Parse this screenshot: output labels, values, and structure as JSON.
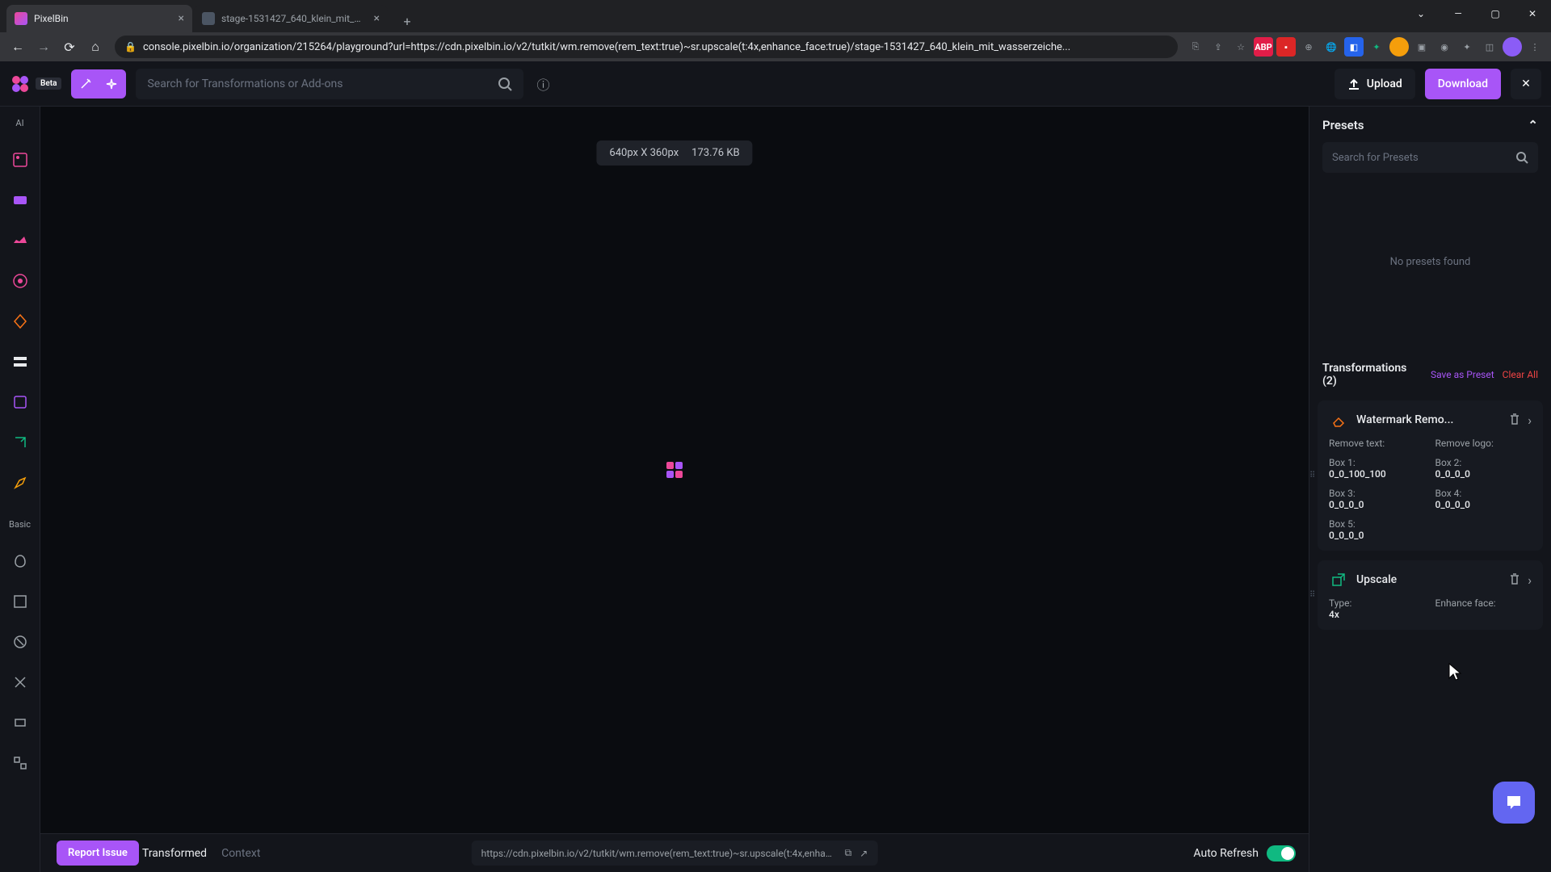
{
  "browser": {
    "tabs": [
      {
        "title": "PixelBin",
        "active": true
      },
      {
        "title": "stage-1531427_640_klein_mit_w...",
        "active": false
      }
    ],
    "url": "console.pixelbin.io/organization/215264/playground?url=https://cdn.pixelbin.io/v2/tutkit/wm.remove(rem_text:true)~sr.upscale(t:4x,enhance_face:true)/stage-1531427_640_klein_mit_wasserzeiche..."
  },
  "header": {
    "beta": "Beta",
    "search_placeholder": "Search for Transformations or Add-ons",
    "upload": "Upload",
    "download": "Download"
  },
  "left_rail": {
    "ai_label": "AI",
    "basic_label": "Basic"
  },
  "canvas": {
    "dimensions": "640px X 360px",
    "filesize": "173.76 KB"
  },
  "bottom": {
    "report": "Report Issue",
    "tabs": {
      "transformed": "Transformed",
      "context": "Context"
    },
    "url": "https://cdn.pixelbin.io/v2/tutkit/wm.remove(rem_text:true)~sr.upscale(t:4x,enhance...",
    "auto_refresh": "Auto Refresh"
  },
  "right": {
    "presets_title": "Presets",
    "preset_search_placeholder": "Search for Presets",
    "no_presets": "No presets found",
    "transformations_title": "Transformations (2)",
    "save_preset": "Save as Preset",
    "clear_all": "Clear All",
    "tx1": {
      "title": "Watermark Remo...",
      "remove_text": "Remove text:",
      "remove_logo": "Remove logo:",
      "box1_label": "Box 1:",
      "box1_val": "0_0_100_100",
      "box2_label": "Box 2:",
      "box2_val": "0_0_0_0",
      "box3_label": "Box 3:",
      "box3_val": "0_0_0_0",
      "box4_label": "Box 4:",
      "box4_val": "0_0_0_0",
      "box5_label": "Box 5:",
      "box5_val": "0_0_0_0"
    },
    "tx2": {
      "title": "Upscale",
      "type_label": "Type:",
      "type_val": "4x",
      "enhance_label": "Enhance face:"
    }
  }
}
